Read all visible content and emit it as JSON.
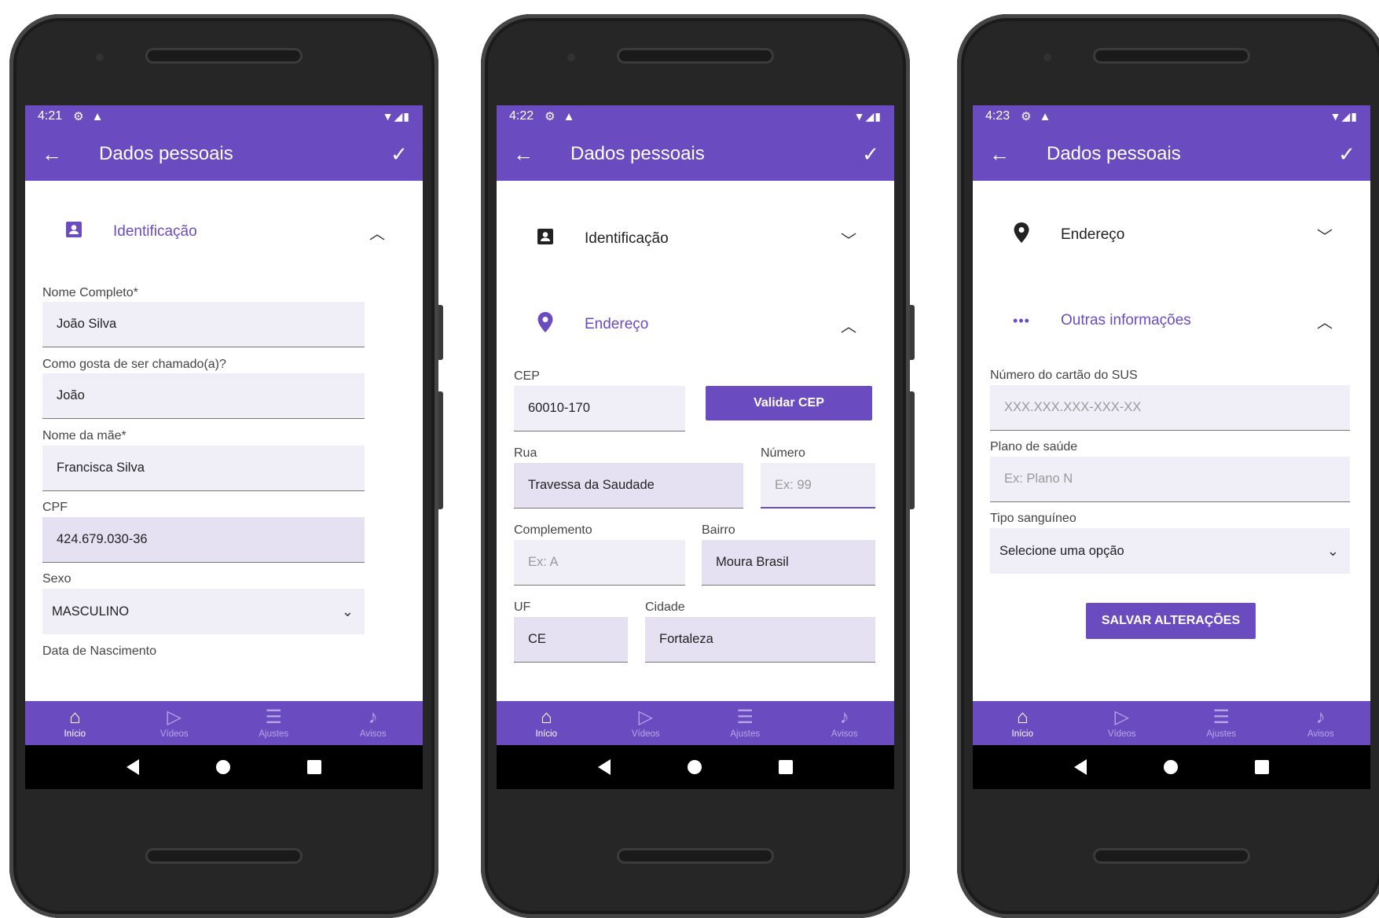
{
  "screens": [
    {
      "time": "4:21",
      "title": "Dados pessoais",
      "identificacao": "Identificação",
      "labels": [
        "Nome Completo*",
        "Como gosta de ser chamado(a)?",
        "Nome da mãe*",
        "CPF",
        "Sexo",
        "Data de Nascimento"
      ],
      "values": [
        "João Silva",
        "João",
        "Francisca Silva",
        "424.679.030-36",
        "MASCULINO"
      ]
    },
    {
      "time": "4:22",
      "title": "Dados pessoais",
      "identificacao": "Identificação",
      "endereco": "Endereço",
      "cep_label": "CEP",
      "cep_value": "60010-170",
      "validar_button": "Validar CEP",
      "rua_label": "Rua",
      "rua_value": "Travessa da Saudade",
      "numero_label": "Número",
      "numero_placeholder": "Ex: 99",
      "complemento_label": "Complemento",
      "complemento_placeholder": "Ex: A",
      "bairro_label": "Bairro",
      "bairro_value": "Moura Brasil",
      "uf_label": "UF",
      "uf_value": "CE",
      "cidade_label": "Cidade",
      "cidade_value": "Fortaleza"
    },
    {
      "time": "4:23",
      "title": "Dados pessoais",
      "endereco": "Endereço",
      "outras": "Outras informações",
      "sus_label": "Número do cartão do SUS",
      "sus_placeholder": "XXX.XXX.XXX-XXX-XX",
      "plano_label": "Plano de saúde",
      "plano_placeholder": "Ex: Plano N",
      "tipo_label": "Tipo sanguíneo",
      "tipo_value": "Selecione uma opção",
      "save_button": "SALVAR ALTERAÇÕES"
    }
  ],
  "bottom_nav": [
    "Início",
    "Vídeos",
    "Ajustes",
    "Avisos"
  ],
  "colors": {
    "primary": "#6b4cc0",
    "field_bg": "#f0eef6",
    "phone_body": "#262626"
  },
  "icons": {
    "back": "arrow-left-icon",
    "confirm": "check-icon",
    "id": "id-card-icon",
    "location": "location-pin-icon",
    "more": "more-horizontal-icon"
  }
}
